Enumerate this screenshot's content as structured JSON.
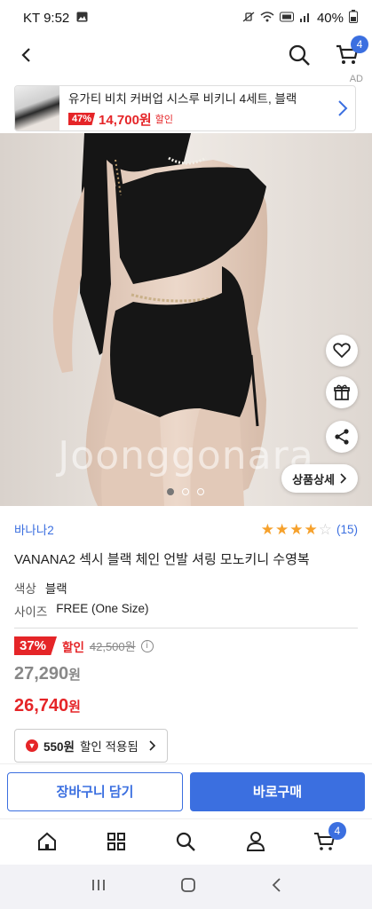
{
  "status_bar": {
    "carrier_time": "KT 9:52",
    "battery": "40%"
  },
  "nav": {
    "cart_count": "4",
    "ad_label": "AD"
  },
  "ad": {
    "title": "유가티 비치 커버업 시스루 비키니 4세트, 블랙",
    "discount": "47%",
    "price": "14,700원",
    "discount_label": "할인"
  },
  "image": {
    "watermark": "Joonggonara",
    "slides": 3,
    "active_slide": 1,
    "detail_button": "상품상세"
  },
  "product": {
    "seller": "바나나2",
    "rating": 4,
    "review_count": "(15)",
    "title": "VANANA2 섹시 블랙 체인 언발 셔링 모노키니 수영복",
    "color_label": "색상",
    "color_value": "블랙",
    "size_label": "사이즈",
    "size_value": "FREE (One Size)",
    "discount_pct": "37%",
    "discount_label": "할인",
    "original_price": "42,500원",
    "price_member_num": "27,290",
    "price_final_num": "26,740",
    "won": "원",
    "coupon_amount": "550원",
    "coupon_text": "할인 적용됨"
  },
  "cta": {
    "cart_label": "장바구니 담기",
    "buy_label": "바로구매"
  },
  "bottom_nav": {
    "cart_count": "4"
  },
  "colors": {
    "accent": "#3b6fe0",
    "sale": "#e52528",
    "star": "#f6a12c"
  }
}
